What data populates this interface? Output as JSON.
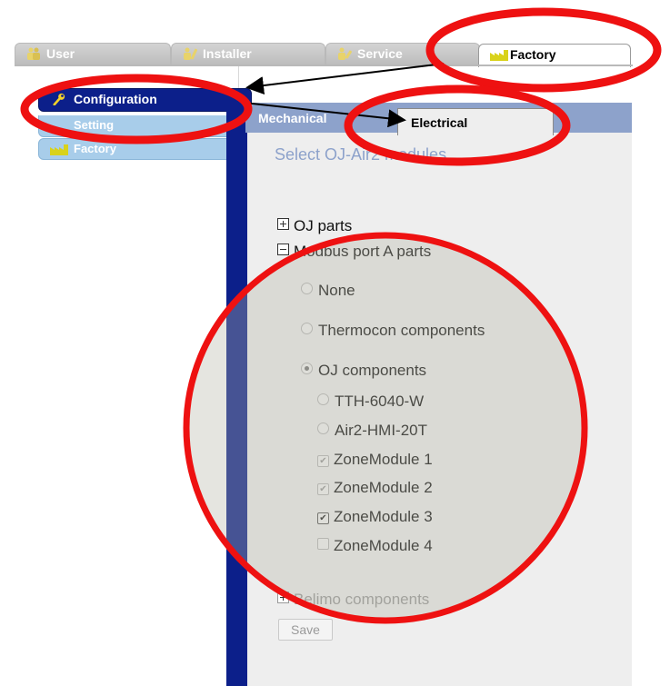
{
  "user_tabs": [
    {
      "label": "User",
      "icon": "users-icon"
    },
    {
      "label": "Installer",
      "icon": "installer-icon"
    },
    {
      "label": "Service",
      "icon": "service-icon"
    },
    {
      "label": "Factory",
      "icon": "factory-icon",
      "active": true
    }
  ],
  "sidebar": {
    "items": [
      {
        "label": "Configuration",
        "icon": "wrench-icon",
        "active": true
      },
      {
        "label": "Setting",
        "icon": "setting-icon"
      },
      {
        "label": "Factory",
        "icon": "factory-icon"
      }
    ]
  },
  "panel": {
    "tabs": [
      {
        "label": "Mechanical"
      },
      {
        "label": "Electrical",
        "active": true
      }
    ],
    "title": "Select OJ-Air2 modules",
    "oj_parts": "OJ parts",
    "modbus_parts": "Modbus port A parts",
    "radios": [
      {
        "label": "None",
        "selected": false
      },
      {
        "label": "Thermocon components",
        "selected": false
      },
      {
        "label": "OJ components",
        "selected": true
      }
    ],
    "oj_options": [
      {
        "label": "TTH-6040-W",
        "type": "radio"
      },
      {
        "label": "Air2-HMI-20T",
        "type": "radio"
      },
      {
        "label": "ZoneModule 1",
        "type": "checkbox",
        "checked": true,
        "disabled": true
      },
      {
        "label": "ZoneModule 2",
        "type": "checkbox",
        "checked": true,
        "disabled": true
      },
      {
        "label": "ZoneModule 3",
        "type": "checkbox",
        "checked": true
      },
      {
        "label": "ZoneModule 4",
        "type": "checkbox",
        "checked": false
      }
    ],
    "belimo": "Belimo components",
    "save_label": "Save"
  },
  "annotation_color": "#ee1111"
}
